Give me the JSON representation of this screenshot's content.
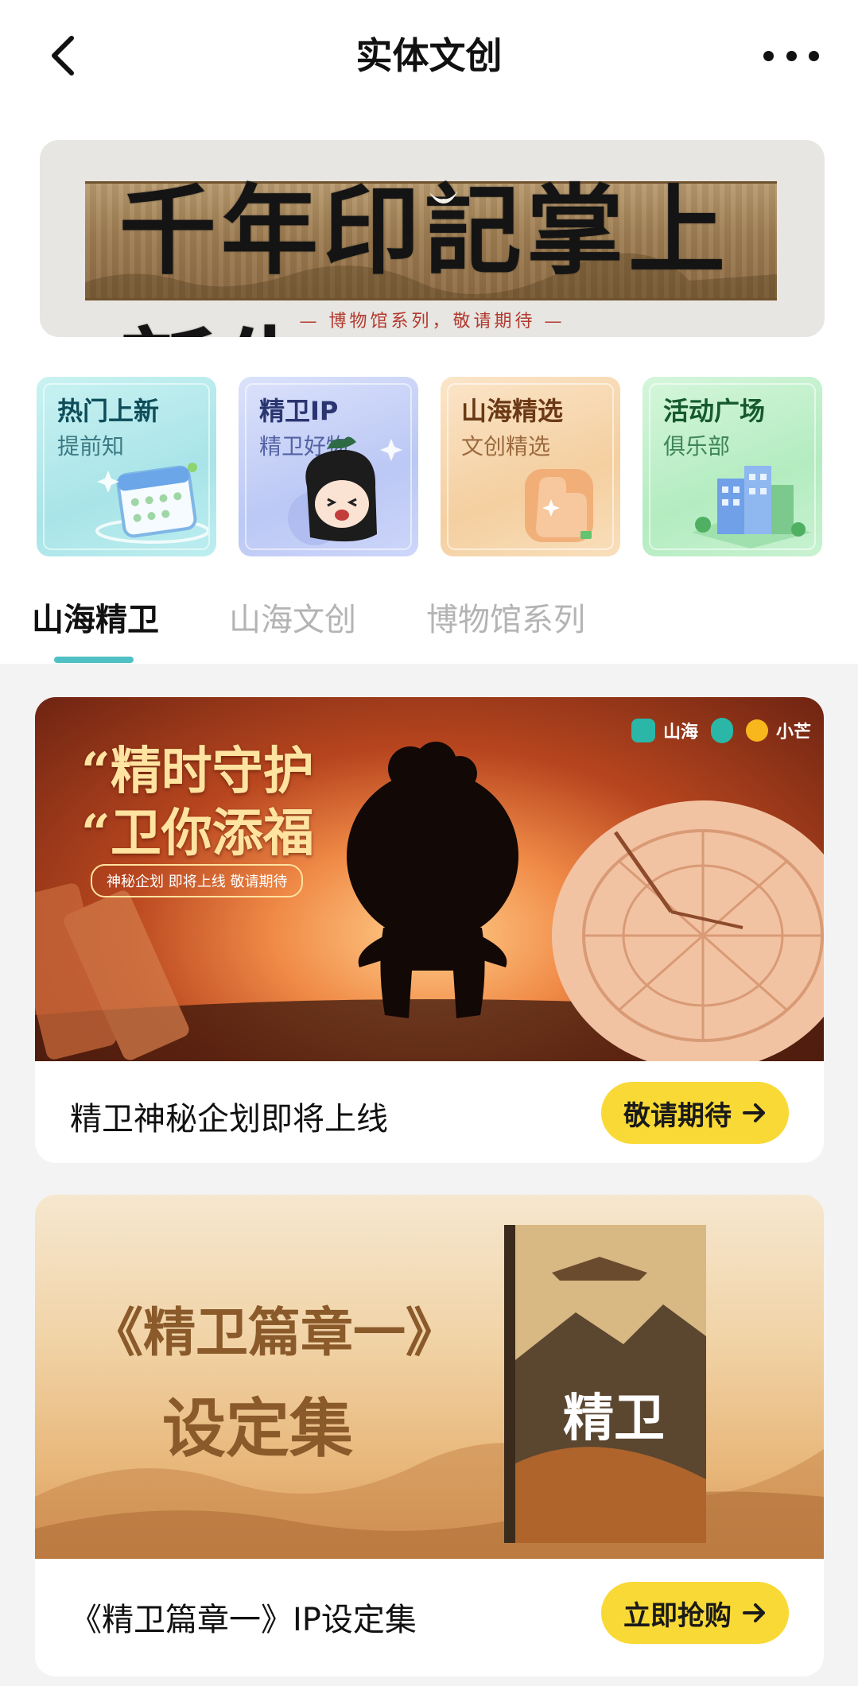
{
  "nav": {
    "title": "实体文创",
    "back_icon": "chevron-left-icon",
    "more_icon": "ellipsis-icon"
  },
  "hero": {
    "headline": "千年印記掌上新生",
    "subline": "— 博物馆系列，敬请期待 —"
  },
  "tiles": [
    {
      "title": "热门上新",
      "subtitle": "提前知",
      "icon": "calendar-icon"
    },
    {
      "title": "精卫IP",
      "subtitle": "精卫好物",
      "icon": "mascot-icon"
    },
    {
      "title": "山海精选",
      "subtitle": "文创精选",
      "icon": "hand-icon"
    },
    {
      "title": "活动广场",
      "subtitle": "俱乐部",
      "icon": "buildings-icon"
    }
  ],
  "tabs": [
    {
      "label": "山海精卫",
      "active": true
    },
    {
      "label": "山海文创",
      "active": false
    },
    {
      "label": "博物馆系列",
      "active": false
    }
  ],
  "cards": [
    {
      "banner": {
        "line1": "“精时守护",
        "line2": "“卫你添福",
        "tagline": "神秘企划 即将上线 敬请期待",
        "brand_a": "山海",
        "brand_b": "小芒"
      },
      "caption": "精卫神秘企划即将上线",
      "cta": "敬请期待",
      "cta_icon": "arrow-right-icon"
    },
    {
      "banner": {
        "line1": "《精卫篇章一》",
        "line2": "设定集",
        "book_title": "精卫"
      },
      "caption": "《精卫篇章一》IP设定集",
      "cta": "立即抢购",
      "cta_icon": "arrow-right-icon"
    }
  ],
  "colors": {
    "accent_tab": "#4fc1c4",
    "cta_yellow": "#f9d935",
    "page_bg": "#f3f3f3"
  }
}
